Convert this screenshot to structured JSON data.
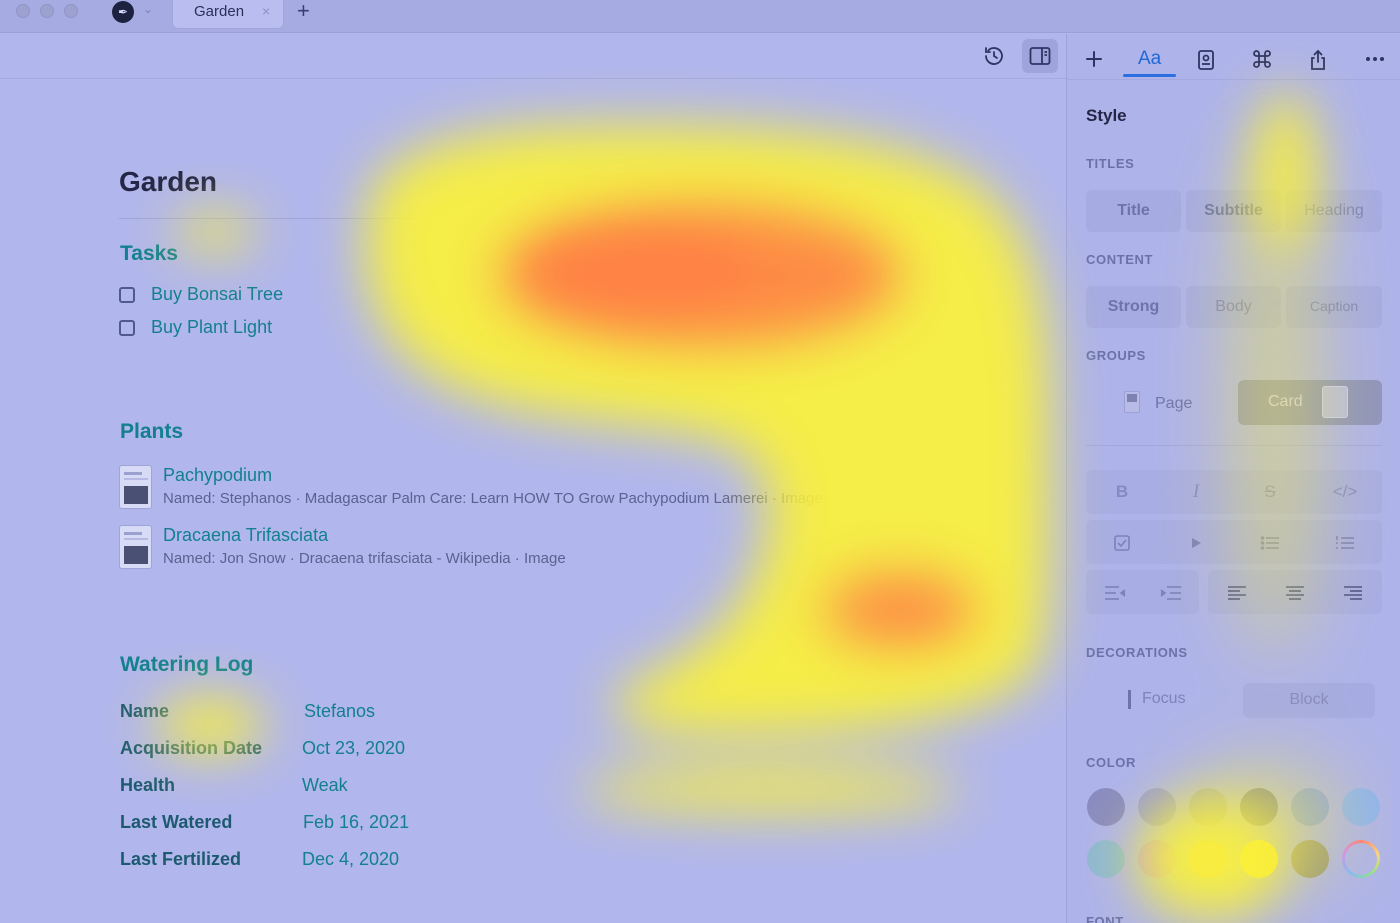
{
  "window": {
    "tab_title": "Garden",
    "tab_close_glyph": "×",
    "new_tab_glyph": "+",
    "app_icon": "app-logo-icon"
  },
  "toolbar": {
    "icons": [
      "history-icon",
      "sidebar-toggle-icon"
    ]
  },
  "document": {
    "title": "Garden",
    "tasks": {
      "heading": "Tasks",
      "items": [
        {
          "label": "Buy Bonsai Tree",
          "checked": false
        },
        {
          "label": "Buy Plant Light",
          "checked": false
        }
      ]
    },
    "plants": {
      "heading": "Plants",
      "items": [
        {
          "name": "Pachypodium",
          "meta": "Named: Stephanos · Madagascar Palm Care: Learn HOW TO Grow Pachypodium Lamerei · Image"
        },
        {
          "name": "Dracaena Trifasciata",
          "meta": "Named: Jon Snow · Dracaena trifasciata - Wikipedia · Image"
        }
      ]
    },
    "watering_log": {
      "heading": "Watering Log",
      "rows": [
        {
          "key": "Name",
          "value": "Stefanos"
        },
        {
          "key": "Acquisition Date",
          "value": "Oct 23, 2020"
        },
        {
          "key": "Health",
          "value": "Weak"
        },
        {
          "key": "Last Watered",
          "value": "Feb 16, 2021"
        },
        {
          "key": "Last Fertilized",
          "value": "Dec 4, 2020"
        }
      ]
    }
  },
  "panel": {
    "tabs": [
      {
        "icon": "plus-icon",
        "active": false
      },
      {
        "label": "Aa",
        "icon": "style-icon",
        "active": true
      },
      {
        "icon": "document-info-icon",
        "active": false
      },
      {
        "icon": "command-icon",
        "active": false
      },
      {
        "icon": "share-icon",
        "active": false
      },
      {
        "icon": "more-icon",
        "active": false
      }
    ],
    "style_heading": "Style",
    "titles": {
      "label": "TITLES",
      "options": [
        "Title",
        "Subtitle",
        "Heading"
      ]
    },
    "content": {
      "label": "CONTENT",
      "options": [
        "Strong",
        "Body",
        "Caption"
      ]
    },
    "groups": {
      "label": "GROUPS",
      "options": [
        "Page",
        "Card"
      ],
      "selected": "Card"
    },
    "formatting": {
      "row1": [
        {
          "label": "B",
          "icon": "bold-icon"
        },
        {
          "label": "I",
          "icon": "italic-icon"
        },
        {
          "label": "S",
          "icon": "strikethrough-icon"
        },
        {
          "label": "</>",
          "icon": "code-icon"
        }
      ],
      "row2_icons": [
        "checkbox-icon",
        "play-icon",
        "bulleted-list-icon",
        "numbered-list-icon"
      ],
      "row3_icons": [
        "outdent-icon",
        "indent-icon",
        "align-left-icon",
        "align-center-icon",
        "align-right-icon"
      ]
    },
    "decorations": {
      "label": "DECORATIONS",
      "options": [
        "Focus",
        "Block"
      ]
    },
    "color": {
      "label": "COLOR",
      "swatches": [
        "#8a8cc0",
        "#9a9dd3",
        "#a2a6c2",
        "#7e83a8",
        "#8fa2e0",
        "#8fb2f0",
        "#8fb7d2",
        "#b79ae6",
        "#d6b27a",
        "#f1e240",
        "#9c9a84",
        "ring"
      ]
    },
    "font_label": "FONT"
  },
  "heatmap": {
    "colors": {
      "cool": "#b1b6ec",
      "warm": "#fbf23a",
      "hot": "#ff7a45"
    }
  }
}
